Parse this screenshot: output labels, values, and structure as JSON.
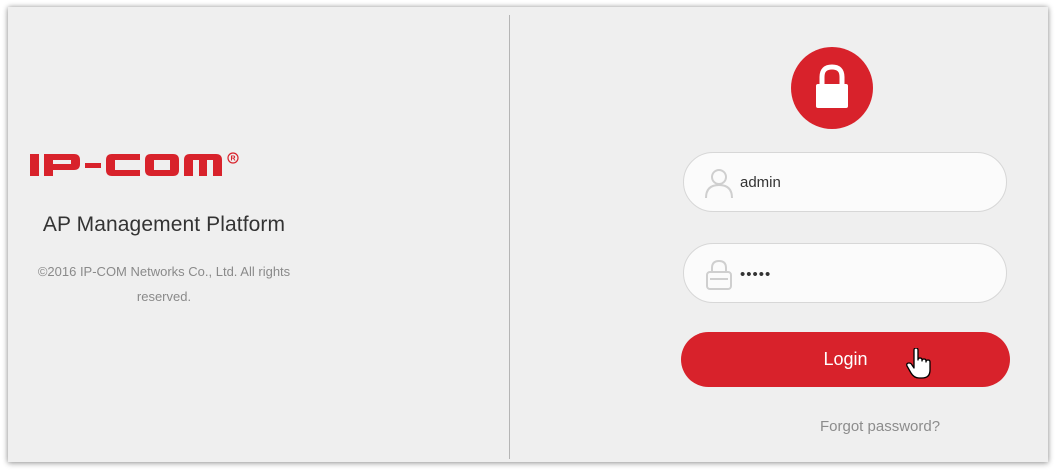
{
  "brand": {
    "logo_text": "IP-COM",
    "registered_mark": "®",
    "platform_title": "AP Management Platform",
    "copyright": "©2016 IP-COM Networks Co., Ltd. All rights reserved."
  },
  "login_form": {
    "lock_icon": "lock-icon",
    "username": {
      "icon": "user-icon",
      "value": "admin"
    },
    "password": {
      "icon": "lock-outline-icon",
      "value": "•••••"
    },
    "login_label": "Login",
    "forgot_password_label": "Forgot password?"
  },
  "colors": {
    "accent": "#d8222b",
    "panel_background": "#efefef",
    "muted_text": "#8c8c8c"
  }
}
